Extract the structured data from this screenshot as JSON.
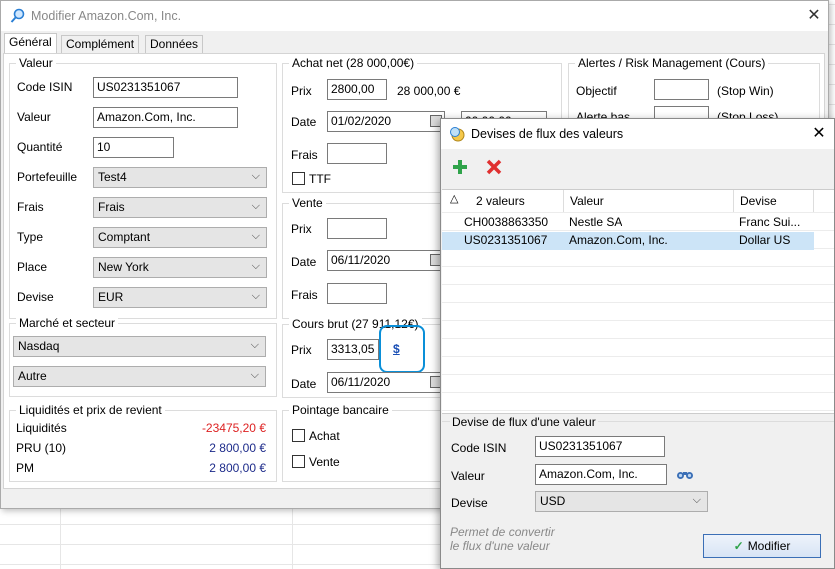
{
  "main": {
    "title": "Modifier Amazon.Com, Inc.",
    "tabs": [
      "Général",
      "Complément",
      "Données"
    ],
    "valeur_group": {
      "title": "Valeur",
      "code_isin_label": "Code ISIN",
      "code_isin": "US0231351067",
      "valeur_label": "Valeur",
      "valeur": "Amazon.Com, Inc.",
      "quantite_label": "Quantité",
      "quantite": "10",
      "portefeuille_label": "Portefeuille",
      "portefeuille": "Test4",
      "frais_label": "Frais",
      "frais": "Frais",
      "type_label": "Type",
      "type": "Comptant",
      "place_label": "Place",
      "place": "New York",
      "devise_label": "Devise",
      "devise": "EUR"
    },
    "marche_group": {
      "title": "Marché et secteur",
      "marche": "Nasdaq",
      "secteur": "Autre"
    },
    "liquidites_group": {
      "title": "Liquidités et prix de revient",
      "liquidites_label": "Liquidités",
      "liquidites": "-23475,20 €",
      "pru_label": "PRU (10)",
      "pru": "2 800,00 €",
      "pm_label": "PM",
      "pm": "2 800,00 €"
    },
    "achat_group": {
      "title": "Achat net (28 000,00€)",
      "prix_label": "Prix",
      "prix": "2800,00",
      "total": "28 000,00 €",
      "date_label": "Date",
      "date": "01/02/2020",
      "time": "00:00:00",
      "frais_label": "Frais",
      "frais": "",
      "ttf_label": "TTF"
    },
    "vente_group": {
      "title": "Vente",
      "prix_label": "Prix",
      "prix": "",
      "date_label": "Date",
      "date": "06/11/2020",
      "frais_label": "Frais",
      "frais": ""
    },
    "cours_group": {
      "title": "Cours brut (27 911,12€)",
      "prix_label": "Prix",
      "prix": "3313,05",
      "currency_link": "$",
      "date_label": "Date",
      "date": "06/11/2020"
    },
    "pointage_group": {
      "title": "Pointage bancaire",
      "achat_label": "Achat",
      "vente_label": "Vente"
    },
    "alertes_group": {
      "title": "Alertes / Risk Management (Cours)",
      "objectif_label": "Objectif",
      "objectif": "",
      "objectif_hint": "(Stop Win)",
      "alerte_bas_label": "Alerte bas",
      "alerte_bas": "",
      "alerte_bas_hint": "(Stop Loss)"
    }
  },
  "dialog": {
    "title": "Devises de flux des valeurs",
    "grid": {
      "columns": [
        "2 valeurs",
        "Valeur",
        "Devise"
      ],
      "rows": [
        {
          "isin": "CH0038863350",
          "valeur": "Nestle SA",
          "devise": "Franc Sui..."
        },
        {
          "isin": "US0231351067",
          "valeur": "Amazon.Com, Inc.",
          "devise": "Dollar US"
        }
      ]
    },
    "form": {
      "title": "Devise de flux d'une valeur",
      "code_isin_label": "Code ISIN",
      "code_isin": "US0231351067",
      "valeur_label": "Valeur",
      "valeur": "Amazon.Com, Inc.",
      "devise_label": "Devise",
      "devise": "USD"
    },
    "hint_line1": "Permet de convertir",
    "hint_line2": "le flux d'une valeur",
    "modifier_label": "Modifier"
  },
  "colors": {
    "negative": "#dd2222",
    "amount": "#1d2b8a",
    "highlight": "#0a8fd8",
    "selected_row": "#cce4f7"
  }
}
